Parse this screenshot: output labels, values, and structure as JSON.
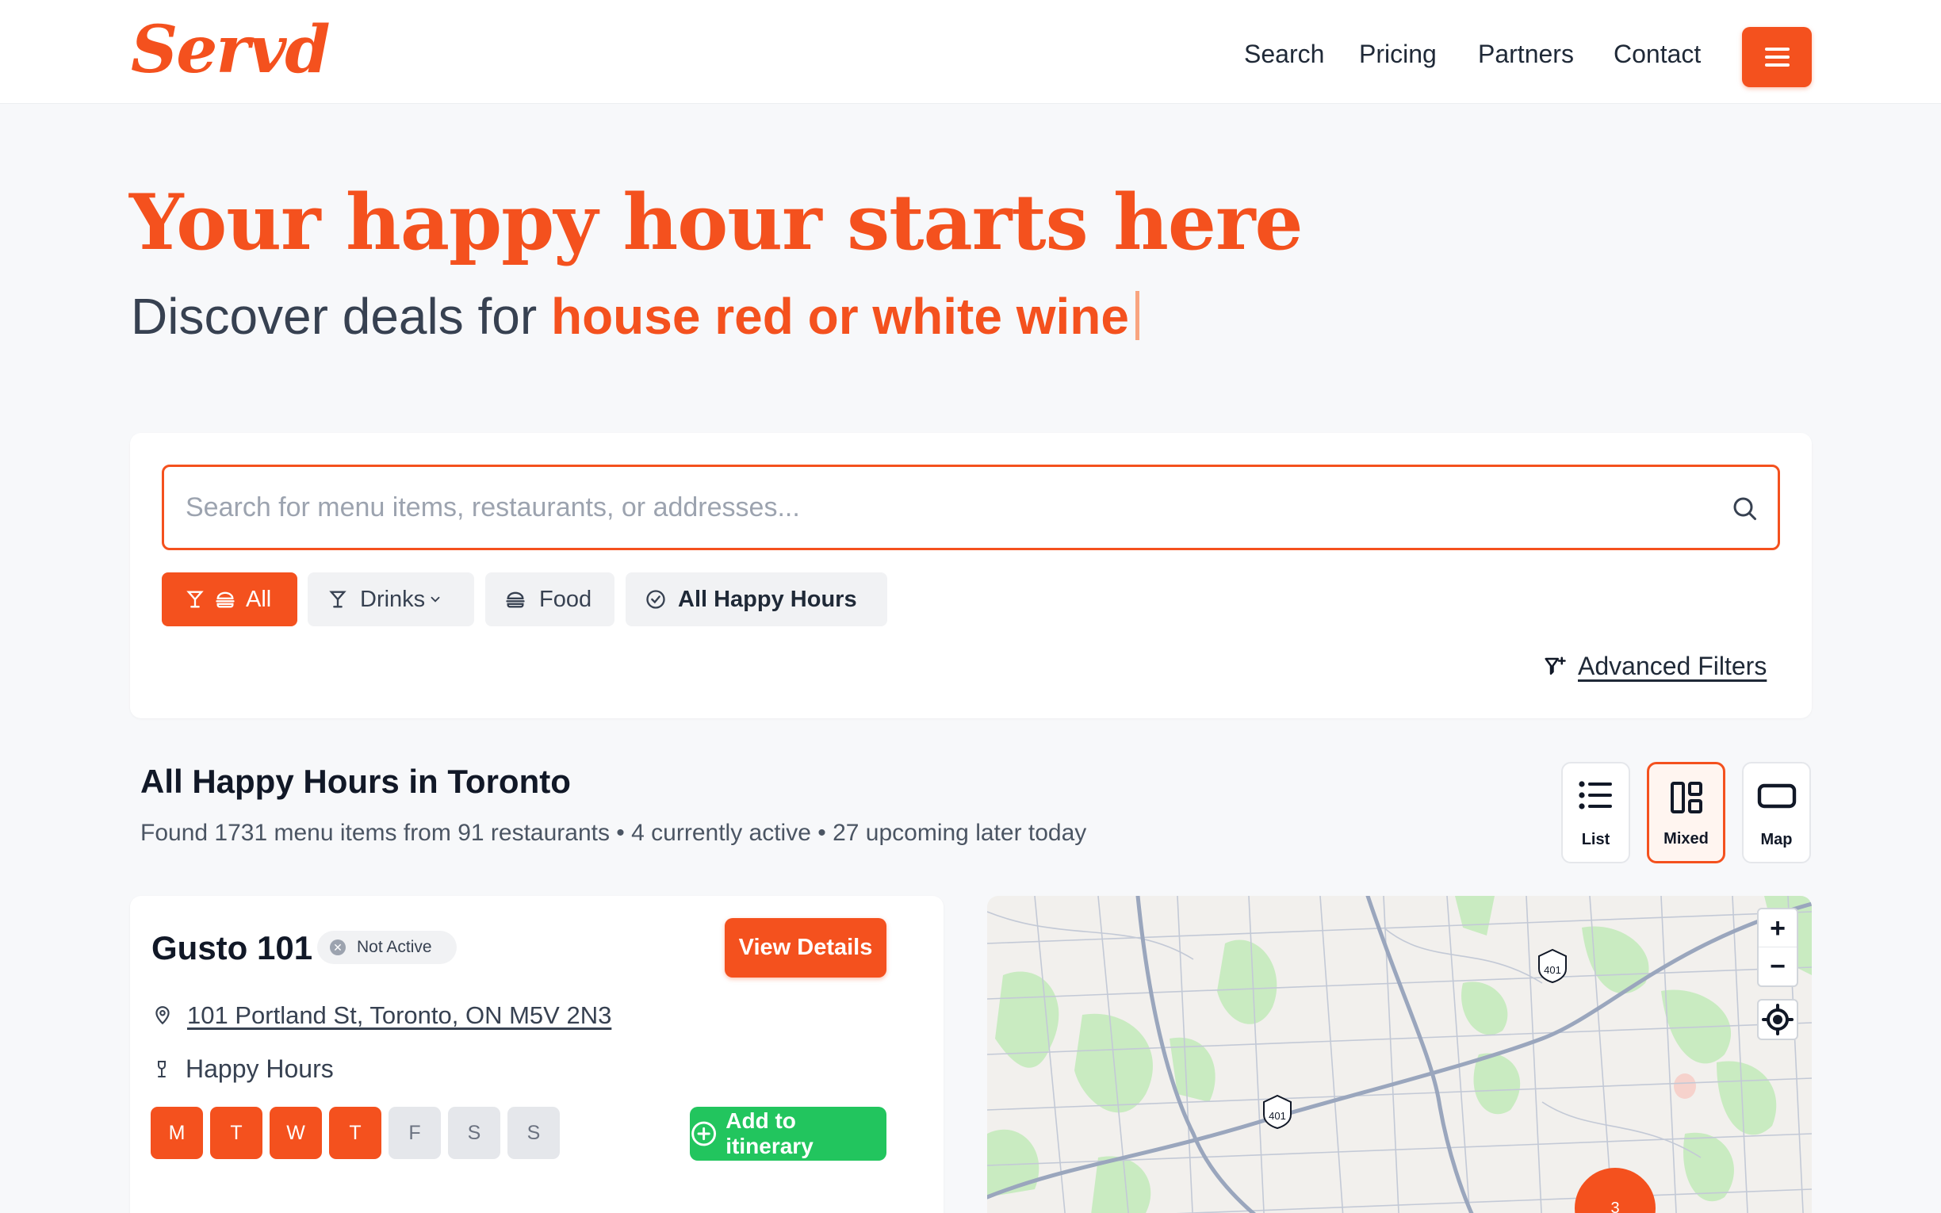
{
  "brand": {
    "name": "Servd",
    "accent": "#f4511e",
    "success": "#22c55e"
  },
  "nav": {
    "search": "Search",
    "pricing": "Pricing",
    "partners": "Partners",
    "contact": "Contact",
    "menu_icon": "hamburger-icon"
  },
  "hero": {
    "title": "Your happy hour starts here",
    "subtitle_prefix": "Discover deals for ",
    "subtitle_highlight": "house red or white wine"
  },
  "search": {
    "placeholder": "Search for menu items, restaurants, or addresses...",
    "value": "",
    "chips": {
      "all": "All",
      "drinks": "Drinks",
      "food": "Food",
      "happy_hours": "All Happy Hours"
    },
    "advanced_filters": "Advanced Filters"
  },
  "results": {
    "title": "All Happy Hours in Toronto",
    "summary": "Found 1731 menu items from 91 restaurants • 4 currently active • 27 upcoming later today",
    "views": {
      "list": "List",
      "mixed": "Mixed",
      "map": "Map",
      "selected": "Mixed"
    }
  },
  "restaurant": {
    "name": "Gusto 101",
    "status": "Not Active",
    "view_details": "View Details",
    "address": "101 Portland St, Toronto, ON M5V 2N3",
    "happy_hours_label": "Happy Hours",
    "days": [
      {
        "label": "M",
        "active": true
      },
      {
        "label": "T",
        "active": true
      },
      {
        "label": "W",
        "active": true
      },
      {
        "label": "T",
        "active": true
      },
      {
        "label": "F",
        "active": false
      },
      {
        "label": "S",
        "active": false
      },
      {
        "label": "S",
        "active": false
      }
    ],
    "add_to_itinerary": "Add to itinerary"
  },
  "map": {
    "zoom_in": "+",
    "zoom_out": "−",
    "highway_shield": "401",
    "cluster_count": "3"
  }
}
